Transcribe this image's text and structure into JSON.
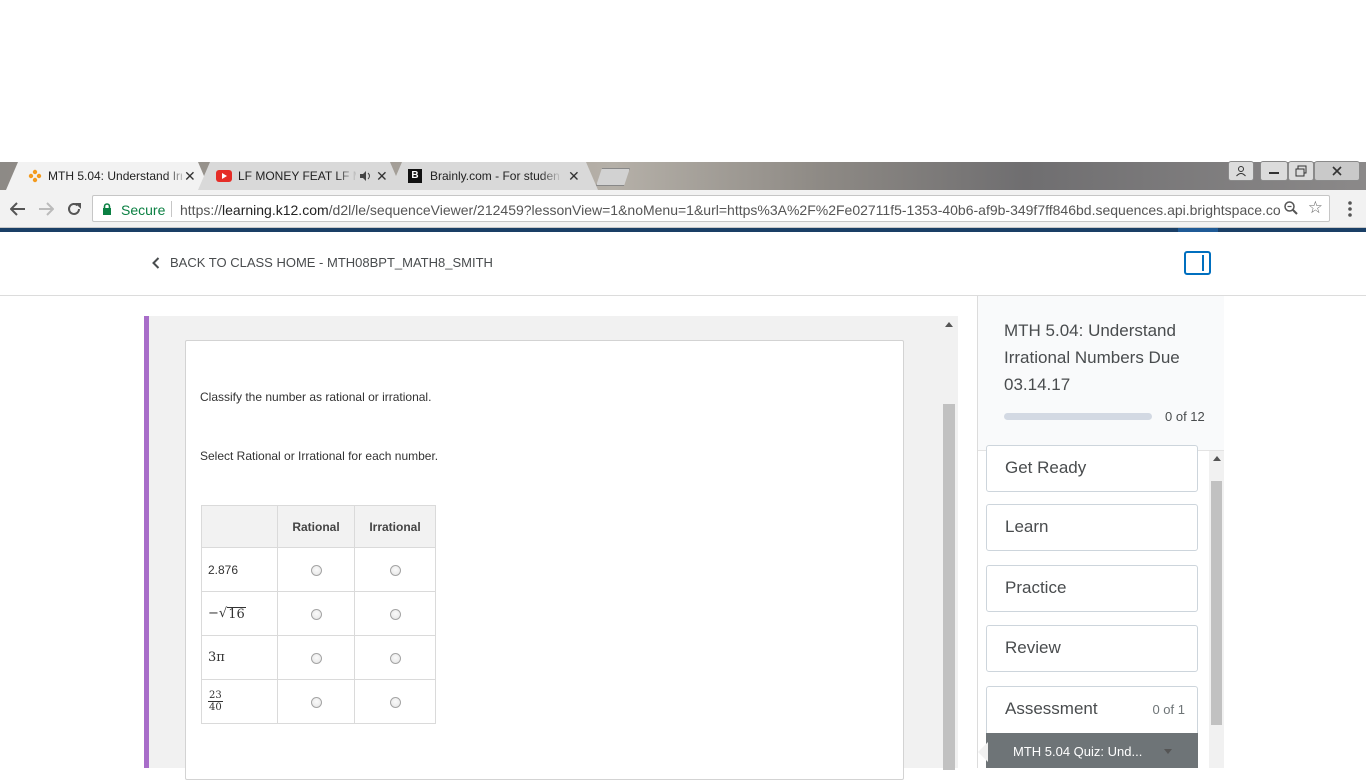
{
  "browser": {
    "tabs": [
      {
        "title": "MTH 5.04: Understand Irr",
        "active": true
      },
      {
        "title": "LF MONEY FEAT LF M",
        "active": false
      },
      {
        "title": "Brainly.com - For student",
        "active": false
      }
    ],
    "address": {
      "secure_label": "Secure",
      "url_scheme": "https://",
      "url_host": "learning.k12.com",
      "url_path": "/d2l/le/sequenceViewer/212459?lessonView=1&noMenu=1&url=https%3A%2F%2Fe02711f5-1353-40b6-af9b-349f7ff846bd.sequences.api.brightspace.co"
    },
    "colors": {
      "secure_green": "#0b8043",
      "accent_blue": "#006fbf",
      "content_border_purple": "#a86dc9"
    }
  },
  "header": {
    "back_label": "BACK TO CLASS HOME - MTH08BPT_MATH8_SMITH"
  },
  "question": {
    "prompt": "Classify the number as rational or irrational.",
    "instruction": "Select Rational or Irrational for each number.",
    "columns": [
      "",
      "Rational",
      "Irrational"
    ],
    "rows": [
      {
        "id": "r1",
        "value": "2.876"
      },
      {
        "id": "r2",
        "sign": "−",
        "radicand": "16"
      },
      {
        "id": "r3",
        "value": "3π"
      },
      {
        "id": "r4",
        "numerator": "23",
        "denominator": "40"
      }
    ]
  },
  "sidebar": {
    "title": "MTH 5.04: Understand Irrational Numbers Due 03.14.17",
    "progress_text": "0 of 12",
    "progress_fraction": 0,
    "modules": [
      {
        "label": "Get Ready",
        "count": ""
      },
      {
        "label": "Learn",
        "count": ""
      },
      {
        "label": "Practice",
        "count": ""
      },
      {
        "label": "Review",
        "count": ""
      },
      {
        "label": "Assessment",
        "count": "0 of 1"
      }
    ],
    "active_item": "MTH 5.04 Quiz: Und..."
  }
}
